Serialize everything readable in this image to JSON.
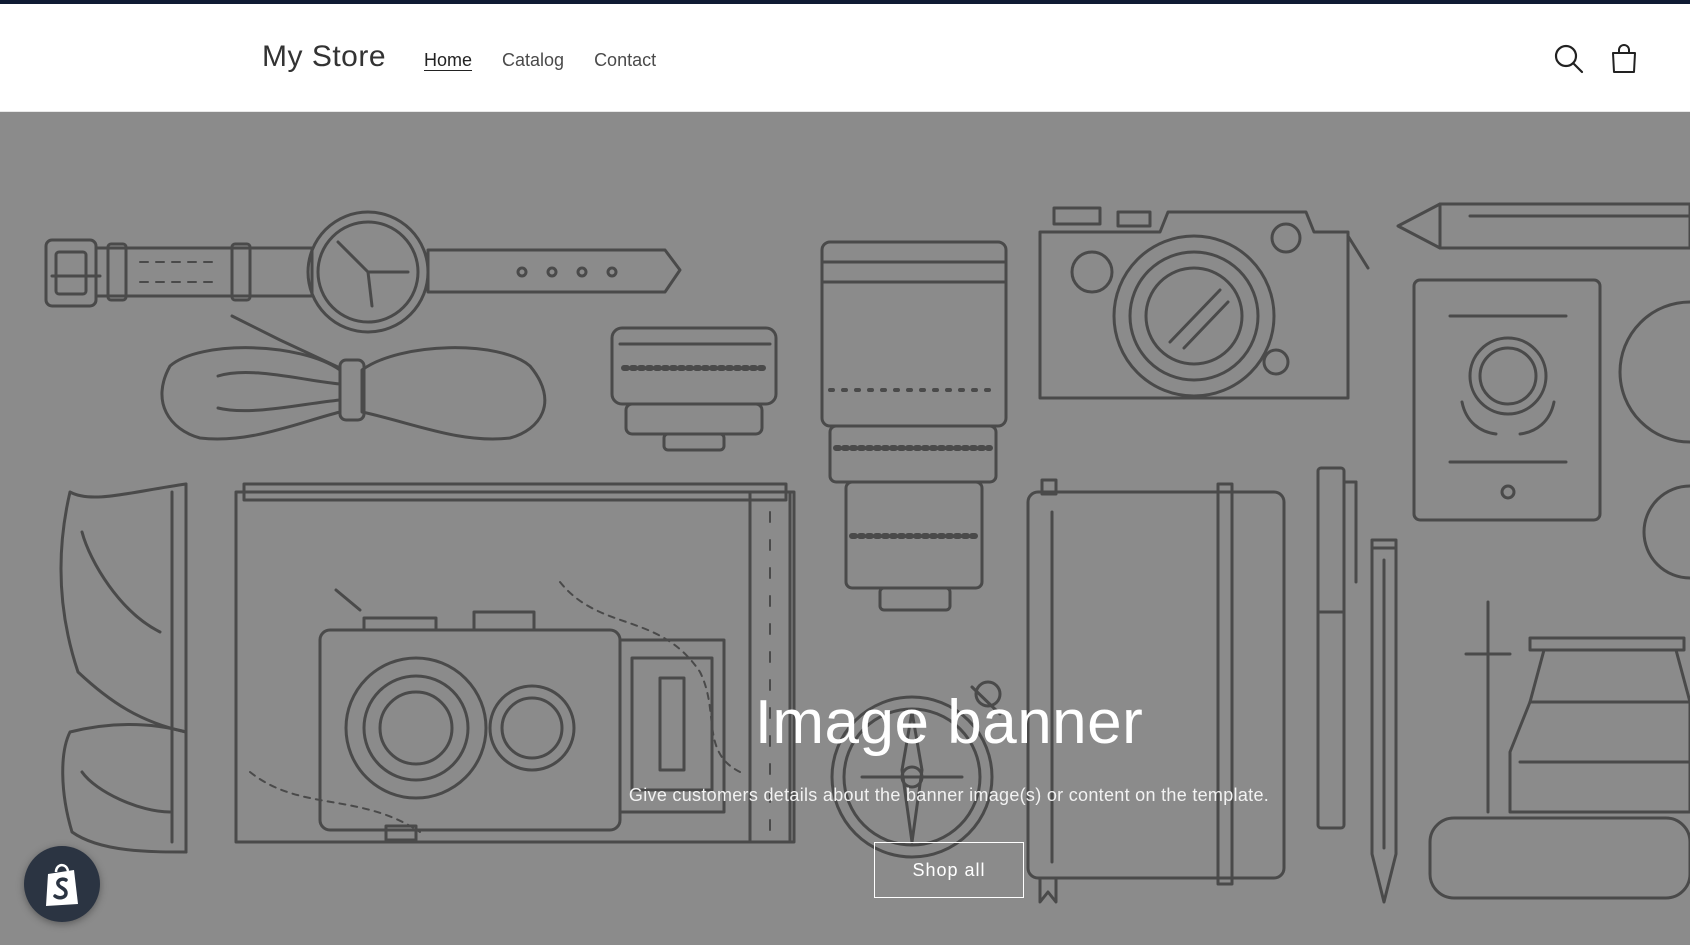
{
  "header": {
    "brand": "My Store",
    "nav": [
      {
        "label": "Home",
        "active": true
      },
      {
        "label": "Catalog",
        "active": false
      },
      {
        "label": "Contact",
        "active": false
      }
    ],
    "icons": [
      "search-icon",
      "cart-icon"
    ]
  },
  "banner": {
    "title": "Image banner",
    "subtitle": "Give customers details about the banner image(s) or content on the template.",
    "button_label": "Shop all"
  },
  "badge": {
    "icon": "shopify-bag-icon"
  },
  "colors": {
    "top_strip": "#0f1b33",
    "banner_bg": "#8b8b8b",
    "line_art": "#4a4a4a",
    "badge_bg": "#2b3442"
  }
}
